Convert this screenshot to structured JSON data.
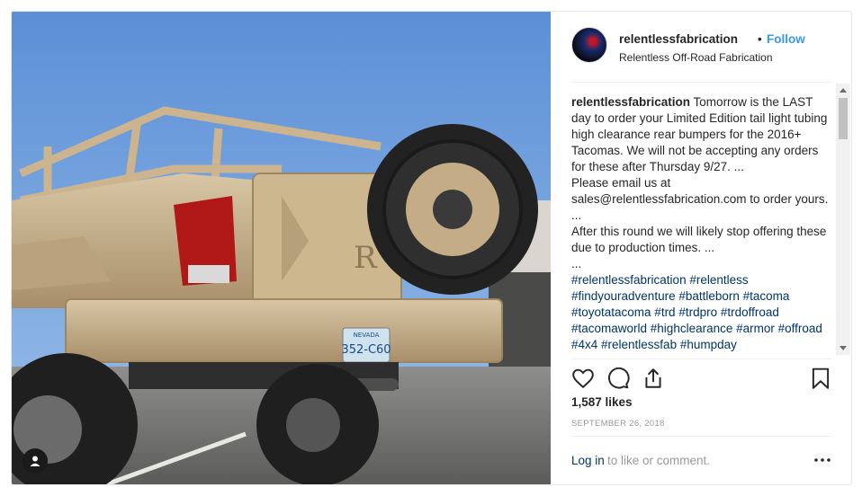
{
  "header": {
    "username": "relentlessfabrication",
    "separator": "•",
    "follow_label": "Follow",
    "subtitle": "Relentless Off-Road Fabrication"
  },
  "caption": {
    "username": "relentlessfabrication",
    "text": " Tomorrow is the LAST day to order your Limited Edition tail light tubing high clearance rear bumpers for the 2016+ Tacomas. We will not be accepting any orders for these after Thursday 9/27. ...\nPlease email us at sales@relentlessfabrication.com to order yours. ...\nAfter this round we will likely stop offering these due to production times. ...\n...\n",
    "hashtags": "#relentlessfabrication #relentless #findyouradventure #battleborn #tacoma #toyotatacoma #trd #trdpro #trdoffroad #tacomaworld #highclearance #armor #offroad #4x4 #relentlessfab #humpday"
  },
  "post": {
    "likes": "1,587 likes",
    "date": "SEPTEMBER 26, 2018"
  },
  "comment_bar": {
    "login_label": "Log in",
    "login_rest": " to like or comment."
  },
  "image": {
    "plate_state": "NEVADA",
    "plate_number": "352-C60"
  },
  "icons": [
    "heart-icon",
    "comment-icon",
    "share-icon",
    "bookmark-icon",
    "more-options-icon",
    "user-tag-icon"
  ],
  "colors": {
    "link_blue": "#3897f0",
    "hashtag_blue": "#003569",
    "muted_gray": "#999999"
  }
}
